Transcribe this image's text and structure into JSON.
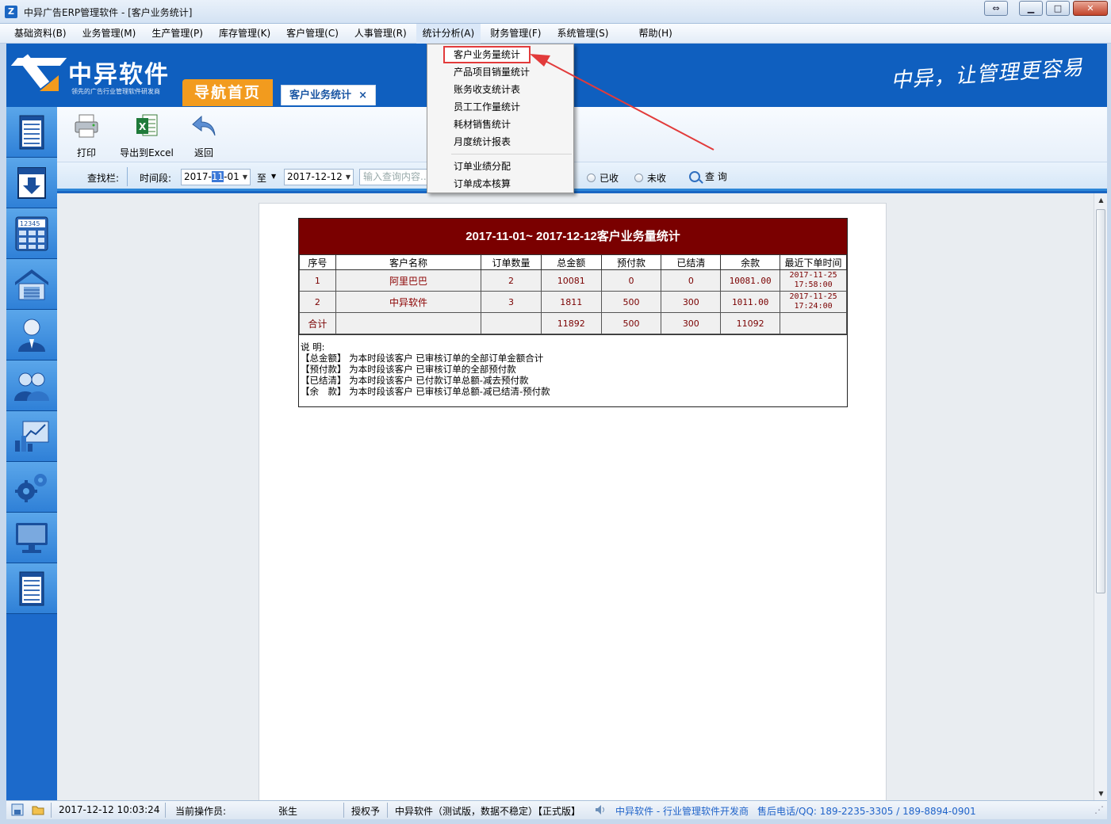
{
  "window": {
    "title": "中异广告ERP管理软件 - [客户业务统计]",
    "icon_letter": "Z",
    "buttons": [
      "minimize",
      "maximize",
      "close"
    ]
  },
  "menubar": {
    "items": [
      {
        "label": "基础资料(B)"
      },
      {
        "label": "业务管理(M)"
      },
      {
        "label": "生产管理(P)"
      },
      {
        "label": "库存管理(K)"
      },
      {
        "label": "客户管理(C)"
      },
      {
        "label": "人事管理(R)"
      },
      {
        "label": "统计分析(A)"
      },
      {
        "label": "财务管理(F)"
      },
      {
        "label": "系统管理(S)"
      },
      {
        "label": "帮助(H)"
      }
    ]
  },
  "dropdown": {
    "items": [
      {
        "label": "客户业务量统计",
        "highlighted": true
      },
      {
        "label": "产品项目销量统计"
      },
      {
        "label": "账务收支统计表"
      },
      {
        "label": "员工工作量统计"
      },
      {
        "label": "耗材销售统计"
      },
      {
        "label": "月度统计报表"
      }
    ],
    "items2": [
      {
        "label": "订单业绩分配"
      },
      {
        "label": "订单成本核算"
      }
    ]
  },
  "header": {
    "logo_title": "中异软件",
    "logo_sub": "领先的广告行业管理软件研发商",
    "nav_home": "导航首页",
    "active_tab": "客户业务统计",
    "tab_close": "×",
    "slogan": "中异，让管理更容易"
  },
  "sidebar": {
    "items": [
      "document-icon",
      "download-icon",
      "calculator-icon",
      "warehouse-icon",
      "user-icon",
      "group-icon",
      "chart-icon",
      "gears-icon",
      "monitor-icon",
      "notes-icon"
    ],
    "calc_digits": "12345"
  },
  "toolbar": {
    "print": "打印",
    "export": "导出到Excel",
    "back": "返回"
  },
  "search": {
    "label": "查找栏:",
    "period_label": "时间段:",
    "date_from_prefix": "2017-",
    "date_from_sel": "11",
    "date_from_suffix": "-01",
    "to_label": "至",
    "date_to": "2017-12-12",
    "keyword_placeholder": "输入查询内容...",
    "radio_received": "已收",
    "radio_unreceived": "未收",
    "query_label": "查 询"
  },
  "report": {
    "title": "2017-11-01~ 2017-12-12客户业务量统计",
    "columns": [
      "序号",
      "客户名称",
      "订单数量",
      "总金额",
      "预付款",
      "已结清",
      "余款",
      "最近下单时间"
    ],
    "rows": [
      {
        "no": "1",
        "name": "阿里巴巴",
        "orders": "2",
        "total": "10081",
        "prepaid": "0",
        "settled": "0",
        "balance": "10081.00",
        "time1": "2017-11-25",
        "time2": "17:58:00"
      },
      {
        "no": "2",
        "name": "中异软件",
        "orders": "3",
        "total": "1811",
        "prepaid": "500",
        "settled": "300",
        "balance": "1011.00",
        "time1": "2017-11-25",
        "time2": "17:24:00"
      }
    ],
    "total_row": {
      "label": "合计",
      "orders": "",
      "total": "11892",
      "prepaid": "500",
      "settled": "300",
      "balance": "11092",
      "time": ""
    },
    "notes_title": "说 明:",
    "notes": [
      "【总金额】 为本时段该客户 已审核订单的全部订单金额合计",
      "【预付款】 为本时段该客户 已审核订单的全部预付款",
      "【已结清】 为本时段该客户 已付款订单总额-减去预付款",
      "【余　款】 为本时段该客户 已审核订单总额-减已结清-预付款"
    ]
  },
  "statusbar": {
    "datetime": "2017-12-12 10:03:24",
    "operator_label": "当前操作员:",
    "operator": "张生",
    "license_label": "授权予",
    "license": "中异软件（测试版，数据不稳定）【正式版】",
    "company": "中异软件 - 行业管理软件开发商",
    "support": "售后电话/QQ: 189-2235-3305  / 189-8894-0901"
  },
  "colors": {
    "brand_blue": "#0f5fbf",
    "accent_orange": "#f29b1e",
    "report_header": "#7a0000",
    "highlight_red": "#e23b3b"
  }
}
